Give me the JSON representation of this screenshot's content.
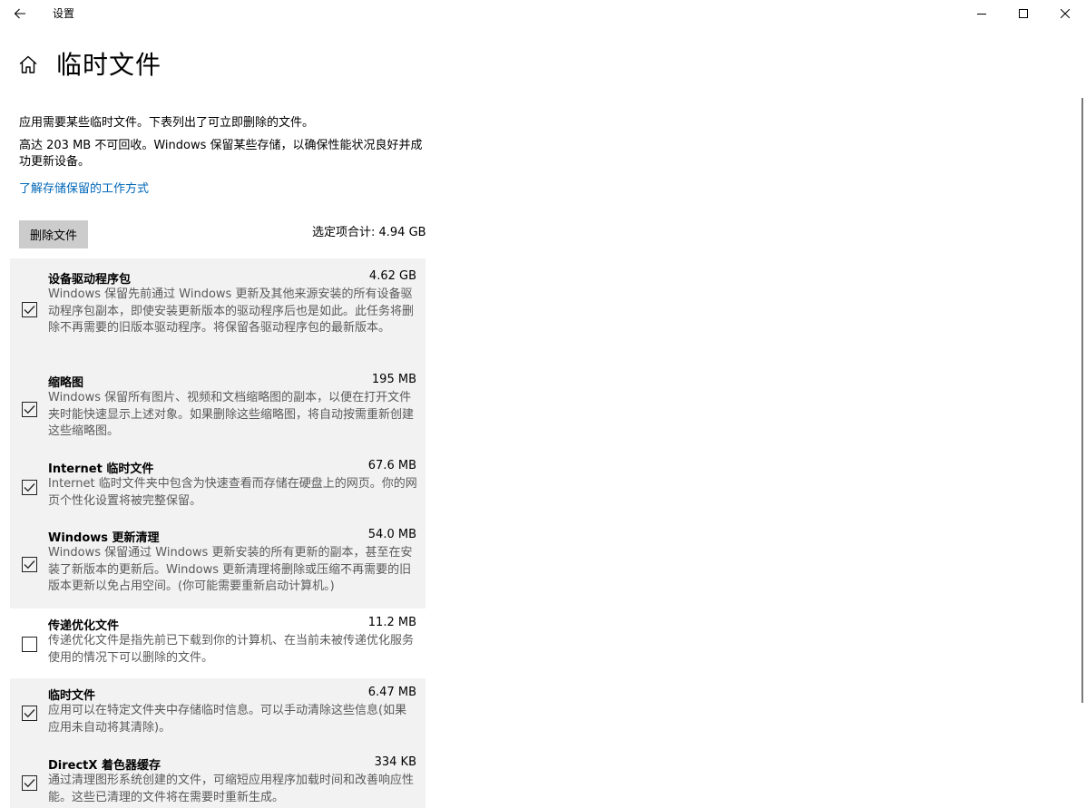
{
  "window": {
    "app_title": "设置"
  },
  "page": {
    "title": "临时文件",
    "description_1": "应用需要某些临时文件。下表列出了可立即删除的文件。",
    "description_2": "高达 203 MB 不可回收。Windows 保留某些存储，以确保性能状况良好并成功更新设备。",
    "learn_link": "了解存储保留的工作方式",
    "delete_button": "删除文件",
    "selected_total": "选定项合计: 4.94 GB"
  },
  "items": [
    {
      "name": "设备驱动程序包",
      "size": "4.62 GB",
      "checked": true,
      "description": "Windows 保留先前通过 Windows 更新及其他来源安装的所有设备驱动程序包副本，即使安装更新版本的驱动程序后也是如此。此任务将删除不再需要的旧版本驱动程序。将保留各驱动程序包的最新版本。"
    },
    {
      "name": "缩略图",
      "size": "195 MB",
      "checked": true,
      "description": "Windows 保留所有图片、视频和文档缩略图的副本，以便在打开文件夹时能快速显示上述对象。如果删除这些缩略图，将自动按需重新创建这些缩略图。"
    },
    {
      "name": "Internet 临时文件",
      "size": "67.6 MB",
      "checked": true,
      "description": "Internet 临时文件夹中包含为快速查看而存储在硬盘上的网页。你的网页个性化设置将被完整保留。"
    },
    {
      "name": "Windows 更新清理",
      "size": "54.0 MB",
      "checked": true,
      "description": "Windows 保留通过 Windows 更新安装的所有更新的副本，甚至在安装了新版本的更新后。Windows 更新清理将删除或压缩不再需要的旧版本更新以免占用空间。(你可能需要重新启动计算机。)"
    },
    {
      "name": "传递优化文件",
      "size": "11.2 MB",
      "checked": false,
      "description": "传递优化文件是指先前已下载到你的计算机、在当前未被传递优化服务使用的情况下可以删除的文件。"
    },
    {
      "name": "临时文件",
      "size": "6.47 MB",
      "checked": true,
      "description": "应用可以在特定文件夹中存储临时信息。可以手动清除这些信息(如果应用未自动将其清除)。"
    },
    {
      "name": "DirectX 着色器缓存",
      "size": "334 KB",
      "checked": true,
      "description": "通过清理图形系统创建的文件，可缩短应用程序加载时间和改善响应性能。这些已清理的文件将在需要时重新生成。"
    }
  ]
}
